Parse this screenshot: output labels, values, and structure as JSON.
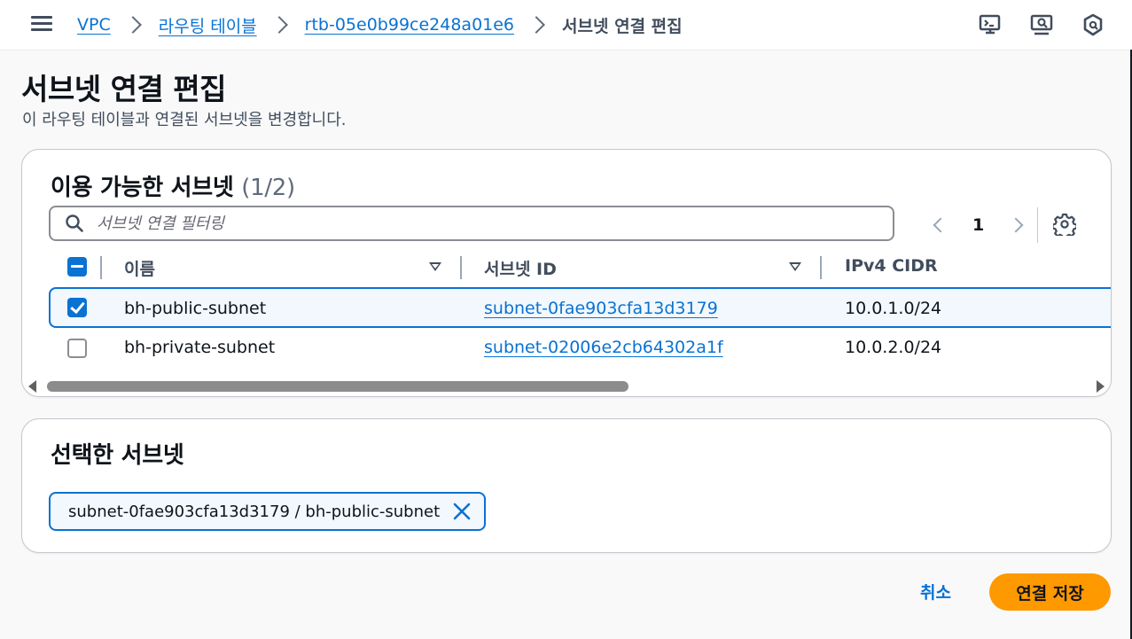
{
  "header": {
    "breadcrumbs": [
      {
        "label": "VPC"
      },
      {
        "label": "라우팅 테이블"
      },
      {
        "label": "rtb-05e0b99ce248a01e6"
      },
      {
        "label": "서브넷 연결 편집"
      }
    ],
    "icons": [
      "menu-icon",
      "remote-desktop-icon",
      "screen-search-icon",
      "shield-icon"
    ]
  },
  "page": {
    "title": "서브넷 연결 편집",
    "description": "이 라우팅 테이블과 연결된 서브넷을 변경합니다."
  },
  "available_subnets": {
    "title": "이용 가능한 서브넷",
    "count": "(1/2)",
    "filter_placeholder": "서브넷 연결 필터링",
    "pagination": {
      "current_page": "1"
    },
    "columns": [
      "이름",
      "서브넷 ID",
      "IPv4 CIDR"
    ],
    "rows": [
      {
        "name": "bh-public-subnet",
        "subnet_id": "subnet-0fae903cfa13d3179",
        "cidr": "10.0.1.0/24",
        "selected": true
      },
      {
        "name": "bh-private-subnet",
        "subnet_id": "subnet-02006e2cb64302a1f",
        "cidr": "10.0.2.0/24",
        "selected": false
      }
    ]
  },
  "selected_subnets": {
    "title": "선택한 서브넷",
    "tokens": [
      {
        "label": "subnet-0fae903cfa13d3179 / bh-public-subnet"
      }
    ]
  },
  "actions": {
    "cancel": "취소",
    "save": "연결 저장"
  },
  "colors": {
    "link": "#0972d3",
    "primary_button": "#ff9900",
    "selected_row_bg": "#f2f8fd"
  }
}
